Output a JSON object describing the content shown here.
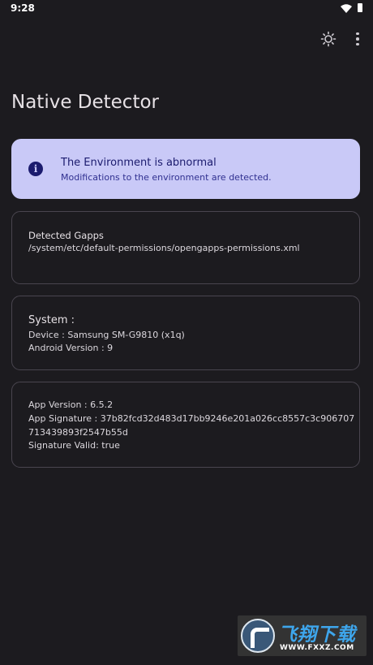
{
  "status_bar": {
    "time": "9:28"
  },
  "app": {
    "title": "Native Detector"
  },
  "alert": {
    "title": "The Environment is abnormal",
    "description": "Modifications to the environment are detected.",
    "icon": "info-icon"
  },
  "gapps_card": {
    "title": "Detected Gapps",
    "path": "/system/etc/default-permissions/opengapps-permissions.xml"
  },
  "system_card": {
    "title": "System :",
    "device": "Device : Samsung SM-G9810  (x1q)",
    "android_version": "Android Version : 9"
  },
  "app_card": {
    "version": "App Version : 6.5.2",
    "signature_line1": "App Signature : 37b82fcd32d483d17bb9246e201a026cc8557c3c906707",
    "signature_line2": "713439893f2547b55d",
    "signature_valid": "Signature Valid: true"
  },
  "watermark": {
    "text": "飞翔下载",
    "url": "WWW.FXXZ.COM"
  },
  "colors": {
    "background": "#1c1b1f",
    "alert_background": "#c9c9f7",
    "alert_text": "#1b1b6e",
    "card_border": "#49454f"
  }
}
